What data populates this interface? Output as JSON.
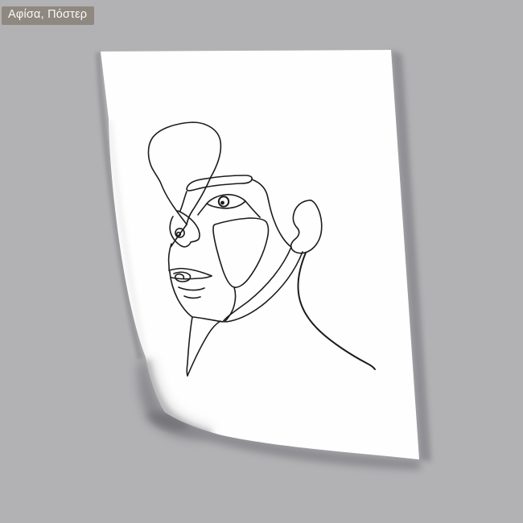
{
  "badge": {
    "label": "Αφίσα, Πόστερ"
  },
  "artwork": {
    "subject": "single continuous line drawing of a face on a white poster sheet with curled bottom-left corner"
  },
  "colors": {
    "background": "#b2b1b3",
    "badge_bg": "#8e8881",
    "badge_text": "#fbfaf9",
    "paper": "#fefefe",
    "line": "#1c1c1c",
    "shadow": "#85858a",
    "shadow_dark": "#636367"
  }
}
